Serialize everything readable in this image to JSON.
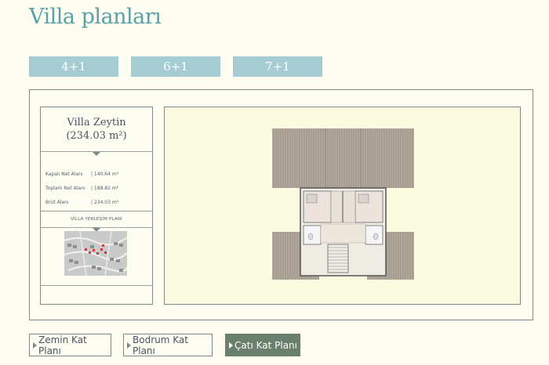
{
  "page": {
    "title": "Villa planları"
  },
  "tabs": [
    {
      "label": "4+1"
    },
    {
      "label": "6+1"
    },
    {
      "label": "7+1"
    }
  ],
  "card": {
    "name": "Villa Zeytin",
    "area": "(234.03 m²)",
    "stats": [
      {
        "label": "Kapalı Net Alanı",
        "value": "| 140.64 m²"
      },
      {
        "label": "Toplam Net Alanı",
        "value": "| 188.82 m²"
      },
      {
        "label": "Brüt Alanı",
        "value": "| 234.03 m²"
      }
    ],
    "site_plan_label": "VİLLA YERLEŞİM PLANI"
  },
  "floor_buttons": [
    {
      "label": "Zemin Kat Planı",
      "active": false
    },
    {
      "label": "Bodrum Kat Planı",
      "active": false
    },
    {
      "label": "Çatı Kat Planı",
      "active": true
    }
  ],
  "colors": {
    "accent_teal": "#5aa0a8",
    "tab_bg": "#a4ccd2",
    "active_button": "#6b7f6d",
    "plan_bg": "#fbfbe2",
    "roof": "#a79e94"
  }
}
